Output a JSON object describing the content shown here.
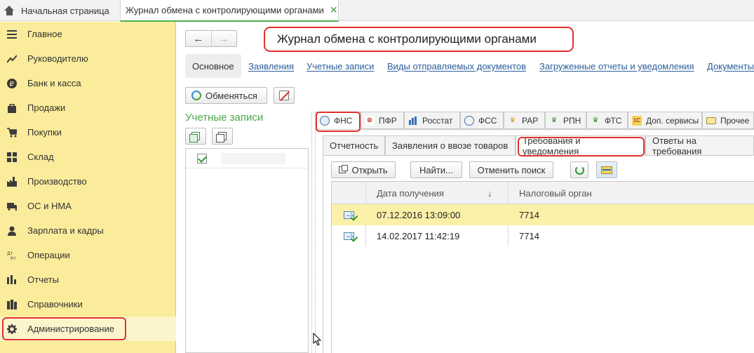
{
  "top_tabs": {
    "home_label": "Начальная страница",
    "doc_label": "Журнал обмена с контролирующими органами",
    "close_glyph": "✕"
  },
  "sidebar": {
    "items": [
      {
        "label": "Главное",
        "icon": "menu-icon"
      },
      {
        "label": "Руководителю",
        "icon": "trend-icon"
      },
      {
        "label": "Банк и касса",
        "icon": "ruble-icon"
      },
      {
        "label": "Продажи",
        "icon": "bag-icon"
      },
      {
        "label": "Покупки",
        "icon": "cart-icon"
      },
      {
        "label": "Склад",
        "icon": "grid-icon"
      },
      {
        "label": "Производство",
        "icon": "factory-icon"
      },
      {
        "label": "ОС и НМА",
        "icon": "truck-icon"
      },
      {
        "label": "Зарплата и кадры",
        "icon": "person-icon"
      },
      {
        "label": "Операции",
        "icon": "dt-kt-icon"
      },
      {
        "label": "Отчеты",
        "icon": "bar-chart-icon"
      },
      {
        "label": "Справочники",
        "icon": "books-icon"
      },
      {
        "label": "Администрирование",
        "icon": "gear-icon"
      }
    ]
  },
  "header": {
    "back_glyph": "←",
    "forward_glyph": "→",
    "title": "Журнал обмена с контролирующими органами"
  },
  "sections": [
    "Основное",
    "Заявления",
    "Учетные записи",
    "Виды отправляемых документов",
    "Загруженные отчеты и уведомления",
    "Документы"
  ],
  "toolbar": {
    "exchange_label": "Обменяться"
  },
  "accounts": {
    "title": "Учетные записи"
  },
  "agency_tabs": [
    "ФНС",
    "ПФР",
    "Росстат",
    "ФСС",
    "РАР",
    "РПН",
    "ФТС",
    "Доп. сервисы",
    "Прочее"
  ],
  "sub_tabs": [
    "Отчетность",
    "Заявления о ввозе товаров",
    "Требования и уведомления",
    "Ответы на требования"
  ],
  "list_toolbar": {
    "open_label": "Открыть",
    "find_label": "Найти...",
    "cancel_search_label": "Отменить поиск"
  },
  "table": {
    "columns": [
      "Дата получения",
      "Налоговый орган"
    ],
    "sort_glyph": "↓",
    "rows": [
      {
        "date": "07.12.2016 13:09:00",
        "office": "7714"
      },
      {
        "date": "14.02.2017 11:42:19",
        "office": "7714"
      }
    ]
  },
  "colors": {
    "sidebar_bg": "#fbec9b",
    "highlight_frame": "#e0312e",
    "link": "#2a5d9b",
    "accent_green": "#4aa64a",
    "selected_row": "#faf0a8"
  }
}
